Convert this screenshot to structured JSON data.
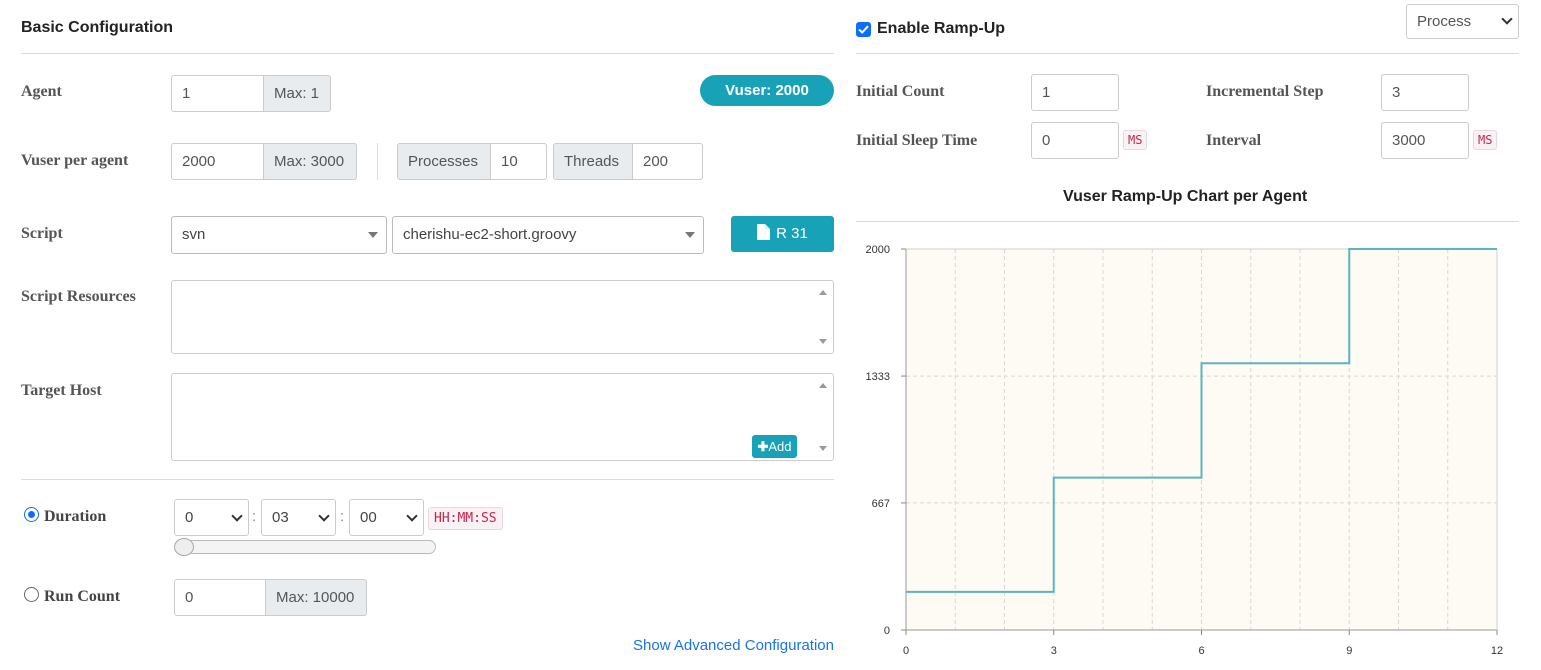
{
  "basic": {
    "title": "Basic Configuration",
    "agent": {
      "label": "Agent",
      "value": "1",
      "max": "Max: 1"
    },
    "vuser_badge": "Vuser: 2000",
    "vuser_per_agent": {
      "label": "Vuser per agent",
      "value": "2000",
      "max": "Max: 3000",
      "processes_label": "Processes",
      "processes_value": "10",
      "threads_label": "Threads",
      "threads_value": "200"
    },
    "script": {
      "label": "Script",
      "repo": "svn",
      "file": "cherishu-ec2-short.groovy",
      "revision_button": "R 31"
    },
    "script_resources": {
      "label": "Script Resources"
    },
    "target_host": {
      "label": "Target Host",
      "add_button": "Add"
    },
    "duration": {
      "label": "Duration",
      "hours": "0",
      "minutes": "03",
      "seconds": "00",
      "separator": ":",
      "format": "HH:MM:SS",
      "slider_position": 0
    },
    "run_count": {
      "label": "Run Count",
      "value": "0",
      "max": "Max: 10000"
    },
    "advanced_link": "Show Advanced Configuration"
  },
  "rampup": {
    "enable_label": "Enable Ramp-Up",
    "enabled": true,
    "mode": "Process",
    "initial_count": {
      "label": "Initial Count",
      "value": "1"
    },
    "incremental_step": {
      "label": "Incremental Step",
      "value": "3"
    },
    "initial_sleep": {
      "label": "Initial Sleep Time",
      "value": "0",
      "unit": "MS"
    },
    "interval": {
      "label": "Interval",
      "value": "3000",
      "unit": "MS"
    }
  },
  "chart_data": {
    "type": "line",
    "step": true,
    "title": "Vuser Ramp-Up Chart per Agent",
    "xlabel": "",
    "ylabel": "",
    "xlim": [
      0,
      12
    ],
    "ylim": [
      0,
      2000
    ],
    "x_ticks": [
      "0",
      "3",
      "6",
      "9",
      "12"
    ],
    "y_ticks": [
      "0",
      "667",
      "1333",
      "2000"
    ],
    "grid": true,
    "points": [
      [
        0,
        200
      ],
      [
        3,
        200
      ],
      [
        3,
        800
      ],
      [
        6,
        800
      ],
      [
        6,
        1400
      ],
      [
        9,
        1400
      ],
      [
        9,
        2000
      ],
      [
        12,
        2000
      ]
    ],
    "colors": {
      "line": "#5ab4c2",
      "plot_bg": "#fdfbf3"
    }
  }
}
